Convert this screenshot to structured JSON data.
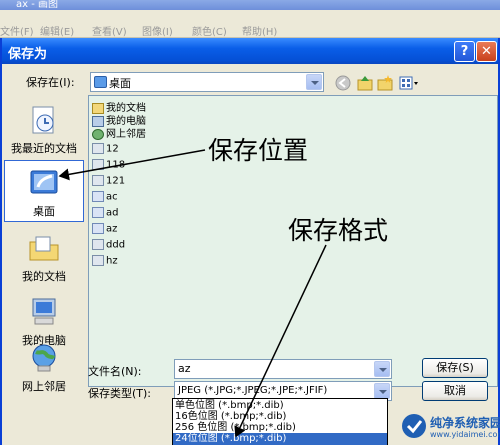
{
  "paint": {
    "title": "ax - 画图",
    "menu": [
      "文件(F)",
      "编辑(E)",
      "查看(V)",
      "图像(I)",
      "颜色(C)",
      "帮助(H)"
    ]
  },
  "dialog": {
    "title": "保存为",
    "help_label": "?",
    "close_label": "✕",
    "save_in_label": "保存在(I):",
    "save_in_value": "桌面"
  },
  "places": [
    {
      "label": "我最近的文档",
      "icon": "recent-documents-icon"
    },
    {
      "label": "桌面",
      "icon": "desktop-icon"
    },
    {
      "label": "我的文档",
      "icon": "my-documents-icon"
    },
    {
      "label": "我的电脑",
      "icon": "my-computer-icon"
    },
    {
      "label": "网上邻居",
      "icon": "network-places-icon"
    }
  ],
  "files": [
    {
      "name": "我的文档",
      "icon": "doc"
    },
    {
      "name": "我的电脑",
      "icon": "pc"
    },
    {
      "name": "网上邻居",
      "icon": "net"
    },
    {
      "name": "12",
      "icon": "jpg"
    },
    {
      "name": "118",
      "icon": "jpg"
    },
    {
      "name": "121",
      "icon": "jpg"
    },
    {
      "name": "ac",
      "icon": "bmp"
    },
    {
      "name": "ad",
      "icon": "bmp"
    },
    {
      "name": "az",
      "icon": "bmp"
    },
    {
      "name": "ddd",
      "icon": "jpg"
    },
    {
      "name": "hz",
      "icon": "jpg"
    }
  ],
  "filename_label": "文件名(N):",
  "filename_value": "az",
  "filetype_label": "保存类型(T):",
  "filetype_value": "JPEG (*.JPG;*.JPEG;*.JPE;*.JFIF)",
  "save_button": "保存(S)",
  "cancel_button": "取消",
  "filetype_options": [
    "单色位图 (*.bmp;*.dib)",
    "16色位图 (*.bmp;*.dib)",
    "256 色位图 (*.bmp;*.dib)",
    "24位位图 (*.bmp;*.dib)"
  ],
  "annotations": {
    "location": "保存位置",
    "format": "保存格式"
  },
  "watermark": {
    "title": "纯净系统家园",
    "url": "www.yidaimei.com"
  },
  "colors": {
    "titlebar": "#0A5EE8",
    "selection": "#316AC5",
    "file_pane": "#E5F2E8"
  }
}
